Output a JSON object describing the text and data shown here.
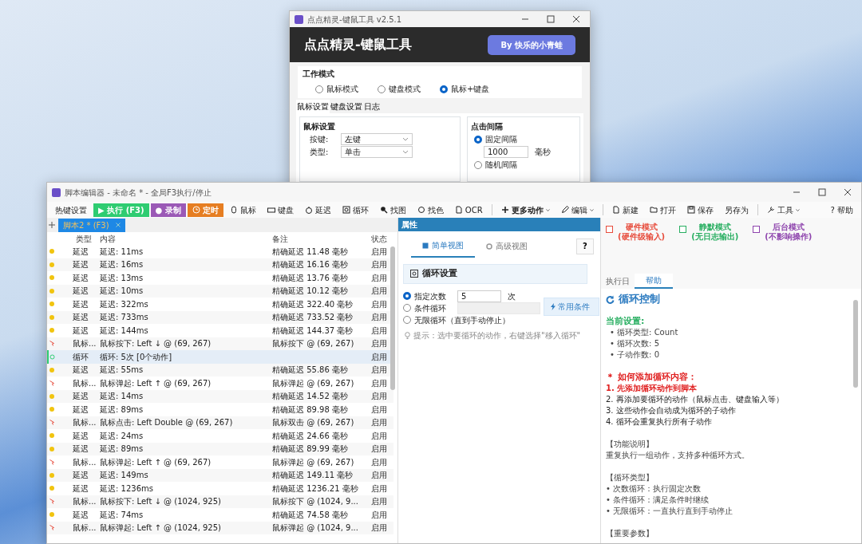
{
  "settings_window": {
    "title": "点点精灵-键鼠工具 v2.5.1",
    "header_title": "点点精灵-键鼠工具",
    "author_button": "By 快乐的小青蛙",
    "work_mode": {
      "label": "工作模式",
      "options": [
        {
          "label": "鼠标模式",
          "selected": false
        },
        {
          "label": "键盘模式",
          "selected": false
        },
        {
          "label": "鼠标+键盘",
          "selected": true
        }
      ]
    },
    "tabs": [
      {
        "label": "鼠标设置",
        "selected": true
      },
      {
        "label": "键盘设置",
        "selected": false
      },
      {
        "label": "日志",
        "selected": false
      }
    ],
    "mouse_settings": {
      "title": "鼠标设置",
      "fields": [
        {
          "label": "按键:",
          "value": "左键"
        },
        {
          "label": "类型:",
          "value": "单击"
        }
      ]
    },
    "click_interval": {
      "title": "点击间隔",
      "fixed": {
        "label": "固定间隔",
        "selected": true
      },
      "value": "1000",
      "unit": "毫秒",
      "random": {
        "label": "随机间隔",
        "selected": false
      }
    }
  },
  "editor_window": {
    "title": "脚本编辑器 - 未命名 * - 全局F3执行/停止",
    "toolbar": [
      {
        "kind": "plain",
        "label": "热键设置",
        "dropdown": false
      },
      {
        "kind": "run",
        "label": "▶ 执行 (F3)",
        "dropdown": false
      },
      {
        "kind": "record",
        "label": "● 录制",
        "dropdown": false
      },
      {
        "kind": "timer",
        "label": "定时",
        "dropdown": false
      },
      {
        "kind": "tool",
        "label": "鼠标",
        "dropdown": false
      },
      {
        "kind": "tool",
        "label": "键盘",
        "dropdown": false
      },
      {
        "kind": "tool",
        "label": "延迟",
        "dropdown": false
      },
      {
        "kind": "tool",
        "label": "循环",
        "dropdown": false
      },
      {
        "kind": "tool",
        "label": "找图",
        "dropdown": false
      },
      {
        "kind": "tool",
        "label": "找色",
        "dropdown": false
      },
      {
        "kind": "tool",
        "label": "OCR",
        "dropdown": false
      },
      {
        "kind": "separator"
      },
      {
        "kind": "bold",
        "label": "更多动作",
        "dropdown": true
      },
      {
        "kind": "tool",
        "label": "编辑",
        "dropdown": true
      },
      {
        "kind": "separator"
      },
      {
        "kind": "tool",
        "label": "新建",
        "dropdown": false
      },
      {
        "kind": "tool",
        "label": "打开",
        "dropdown": false
      },
      {
        "kind": "tool",
        "label": "保存",
        "dropdown": false
      },
      {
        "kind": "tool",
        "label": "另存为",
        "dropdown": false
      },
      {
        "kind": "separator"
      },
      {
        "kind": "tool",
        "label": "工具",
        "dropdown": true
      },
      {
        "kind": "help",
        "label": "? 帮助",
        "dropdown": false
      }
    ],
    "script_tabs": [
      {
        "label": "脚本2 * (F3)",
        "selected": true
      }
    ],
    "columns": [
      "类型",
      "内容",
      "备注",
      "状态"
    ],
    "rows": [
      {
        "kind": "delay",
        "type": "延迟",
        "content": "延迟: 11ms",
        "note": "精确延迟 11.48 毫秒",
        "status": "启用",
        "selected": false
      },
      {
        "kind": "delay",
        "type": "延迟",
        "content": "延迟: 16ms",
        "note": "精确延迟 16.16 毫秒",
        "status": "启用",
        "selected": false
      },
      {
        "kind": "delay",
        "type": "延迟",
        "content": "延迟: 13ms",
        "note": "精确延迟 13.76 毫秒",
        "status": "启用",
        "selected": false
      },
      {
        "kind": "delay",
        "type": "延迟",
        "content": "延迟: 10ms",
        "note": "精确延迟 10.12 毫秒",
        "status": "启用",
        "selected": false
      },
      {
        "kind": "delay",
        "type": "延迟",
        "content": "延迟: 322ms",
        "note": "精确延迟 322.40 毫秒",
        "status": "启用",
        "selected": false
      },
      {
        "kind": "delay",
        "type": "延迟",
        "content": "延迟: 733ms",
        "note": "精确延迟 733.52 毫秒",
        "status": "启用",
        "selected": false
      },
      {
        "kind": "delay",
        "type": "延迟",
        "content": "延迟: 144ms",
        "note": "精确延迟 144.37 毫秒",
        "status": "启用",
        "selected": false
      },
      {
        "kind": "mouse",
        "type": "鼠标...",
        "content": "鼠标按下: Left ↓ @ (69, 267)",
        "note": "鼠标按下 @ (69, 267)",
        "status": "启用",
        "selected": false
      },
      {
        "kind": "loop",
        "type": "循环",
        "content": "循环: 5次 [0个动作]",
        "note": "",
        "status": "启用",
        "selected": true
      },
      {
        "kind": "delay",
        "type": "延迟",
        "content": "延迟: 55ms",
        "note": "精确延迟 55.86 毫秒",
        "status": "启用",
        "selected": false
      },
      {
        "kind": "mouse",
        "type": "鼠标...",
        "content": "鼠标弹起: Left ↑ @ (69, 267)",
        "note": "鼠标弹起 @ (69, 267)",
        "status": "启用",
        "selected": false
      },
      {
        "kind": "delay",
        "type": "延迟",
        "content": "延迟: 14ms",
        "note": "精确延迟 14.52 毫秒",
        "status": "启用",
        "selected": false
      },
      {
        "kind": "delay",
        "type": "延迟",
        "content": "延迟: 89ms",
        "note": "精确延迟 89.98 毫秒",
        "status": "启用",
        "selected": false
      },
      {
        "kind": "mouse",
        "type": "鼠标...",
        "content": "鼠标点击: Left Double @ (69, 267)",
        "note": "鼠标双击 @ (69, 267)",
        "status": "启用",
        "selected": false
      },
      {
        "kind": "delay",
        "type": "延迟",
        "content": "延迟: 24ms",
        "note": "精确延迟 24.66 毫秒",
        "status": "启用",
        "selected": false
      },
      {
        "kind": "delay",
        "type": "延迟",
        "content": "延迟: 89ms",
        "note": "精确延迟 89.99 毫秒",
        "status": "启用",
        "selected": false
      },
      {
        "kind": "mouse",
        "type": "鼠标...",
        "content": "鼠标弹起: Left ↑ @ (69, 267)",
        "note": "鼠标弹起 @ (69, 267)",
        "status": "启用",
        "selected": false
      },
      {
        "kind": "delay",
        "type": "延迟",
        "content": "延迟: 149ms",
        "note": "精确延迟 149.11 毫秒",
        "status": "启用",
        "selected": false
      },
      {
        "kind": "delay",
        "type": "延迟",
        "content": "延迟: 1236ms",
        "note": "精确延迟 1236.21 毫秒",
        "status": "启用",
        "selected": false
      },
      {
        "kind": "mouse",
        "type": "鼠标...",
        "content": "鼠标按下: Left ↓ @ (1024, 925)",
        "note": "鼠标按下 @ (1024, 9...",
        "status": "启用",
        "selected": false
      },
      {
        "kind": "delay",
        "type": "延迟",
        "content": "延迟: 74ms",
        "note": "精确延迟 74.58 毫秒",
        "status": "启用",
        "selected": false
      },
      {
        "kind": "mouse",
        "type": "鼠标...",
        "content": "鼠标弹起: Left ↑ @ (1024, 925)",
        "note": "鼠标弹起 @ (1024, 9...",
        "status": "启用",
        "selected": false
      }
    ],
    "properties": {
      "header": "属性",
      "view_tabs": [
        {
          "label": "简单视图",
          "selected": true
        },
        {
          "label": "高级视图",
          "selected": false
        }
      ],
      "help_button": "?",
      "section_title": "循环设置",
      "loop_options": [
        {
          "kind": "count",
          "label": "指定次数",
          "selected": true,
          "value": "5",
          "unit": "次"
        },
        {
          "kind": "condition",
          "label": "条件循环",
          "selected": false,
          "button": "常用条件"
        },
        {
          "kind": "plain",
          "label": "无限循环（直到手动停止）",
          "selected": false
        }
      ],
      "hint": "提示：选中要循环的动作，右键选择\"移入循环\""
    },
    "modes": [
      {
        "label": "硬件模式",
        "sub": "(硬件级输入)",
        "color": "#e74c3c",
        "checked": false
      },
      {
        "label": "静默模式",
        "sub": "(无日志输出)",
        "color": "#27ae60",
        "checked": false
      },
      {
        "label": "后台模式",
        "sub": "(不影响操作)",
        "color": "#8e44ad",
        "checked": false
      }
    ],
    "side_tabs": [
      {
        "label": "执行日",
        "selected": false
      },
      {
        "label": "帮助",
        "selected": true
      }
    ],
    "help": [
      {
        "kind": "title",
        "text": "循环控制"
      },
      {
        "kind": "heading-green",
        "text": "当前设置:"
      },
      {
        "kind": "bullet",
        "text": "• 循环类型: Count"
      },
      {
        "kind": "bullet",
        "text": "• 循环次数: 5"
      },
      {
        "kind": "bullet",
        "text": "• 子动作数: 0"
      },
      {
        "kind": "heading-red",
        "text": "＊ 如何添加循环内容："
      },
      {
        "kind": "step-red",
        "text": "1. 先添加循环动作到脚本"
      },
      {
        "kind": "step",
        "text": "2. 再添加要循环的动作（鼠标点击、键盘输入等）"
      },
      {
        "kind": "step",
        "text": "3. 这些动作会自动成为循环的子动作"
      },
      {
        "kind": "step",
        "text": "4. 循环会重复执行所有子动作"
      },
      {
        "kind": "section",
        "text": "【功能说明】"
      },
      {
        "kind": "paragraph",
        "text": "重复执行一组动作，支持多种循环方式。"
      },
      {
        "kind": "section",
        "text": "【循环类型】"
      },
      {
        "kind": "paragraph",
        "text": "• 次数循环：执行固定次数"
      },
      {
        "kind": "paragraph",
        "text": "• 条件循环：满足条件时继续"
      },
      {
        "kind": "paragraph",
        "text": "• 无限循环：一直执行直到手动停止"
      },
      {
        "kind": "section",
        "text": "【重要参数】"
      }
    ]
  }
}
